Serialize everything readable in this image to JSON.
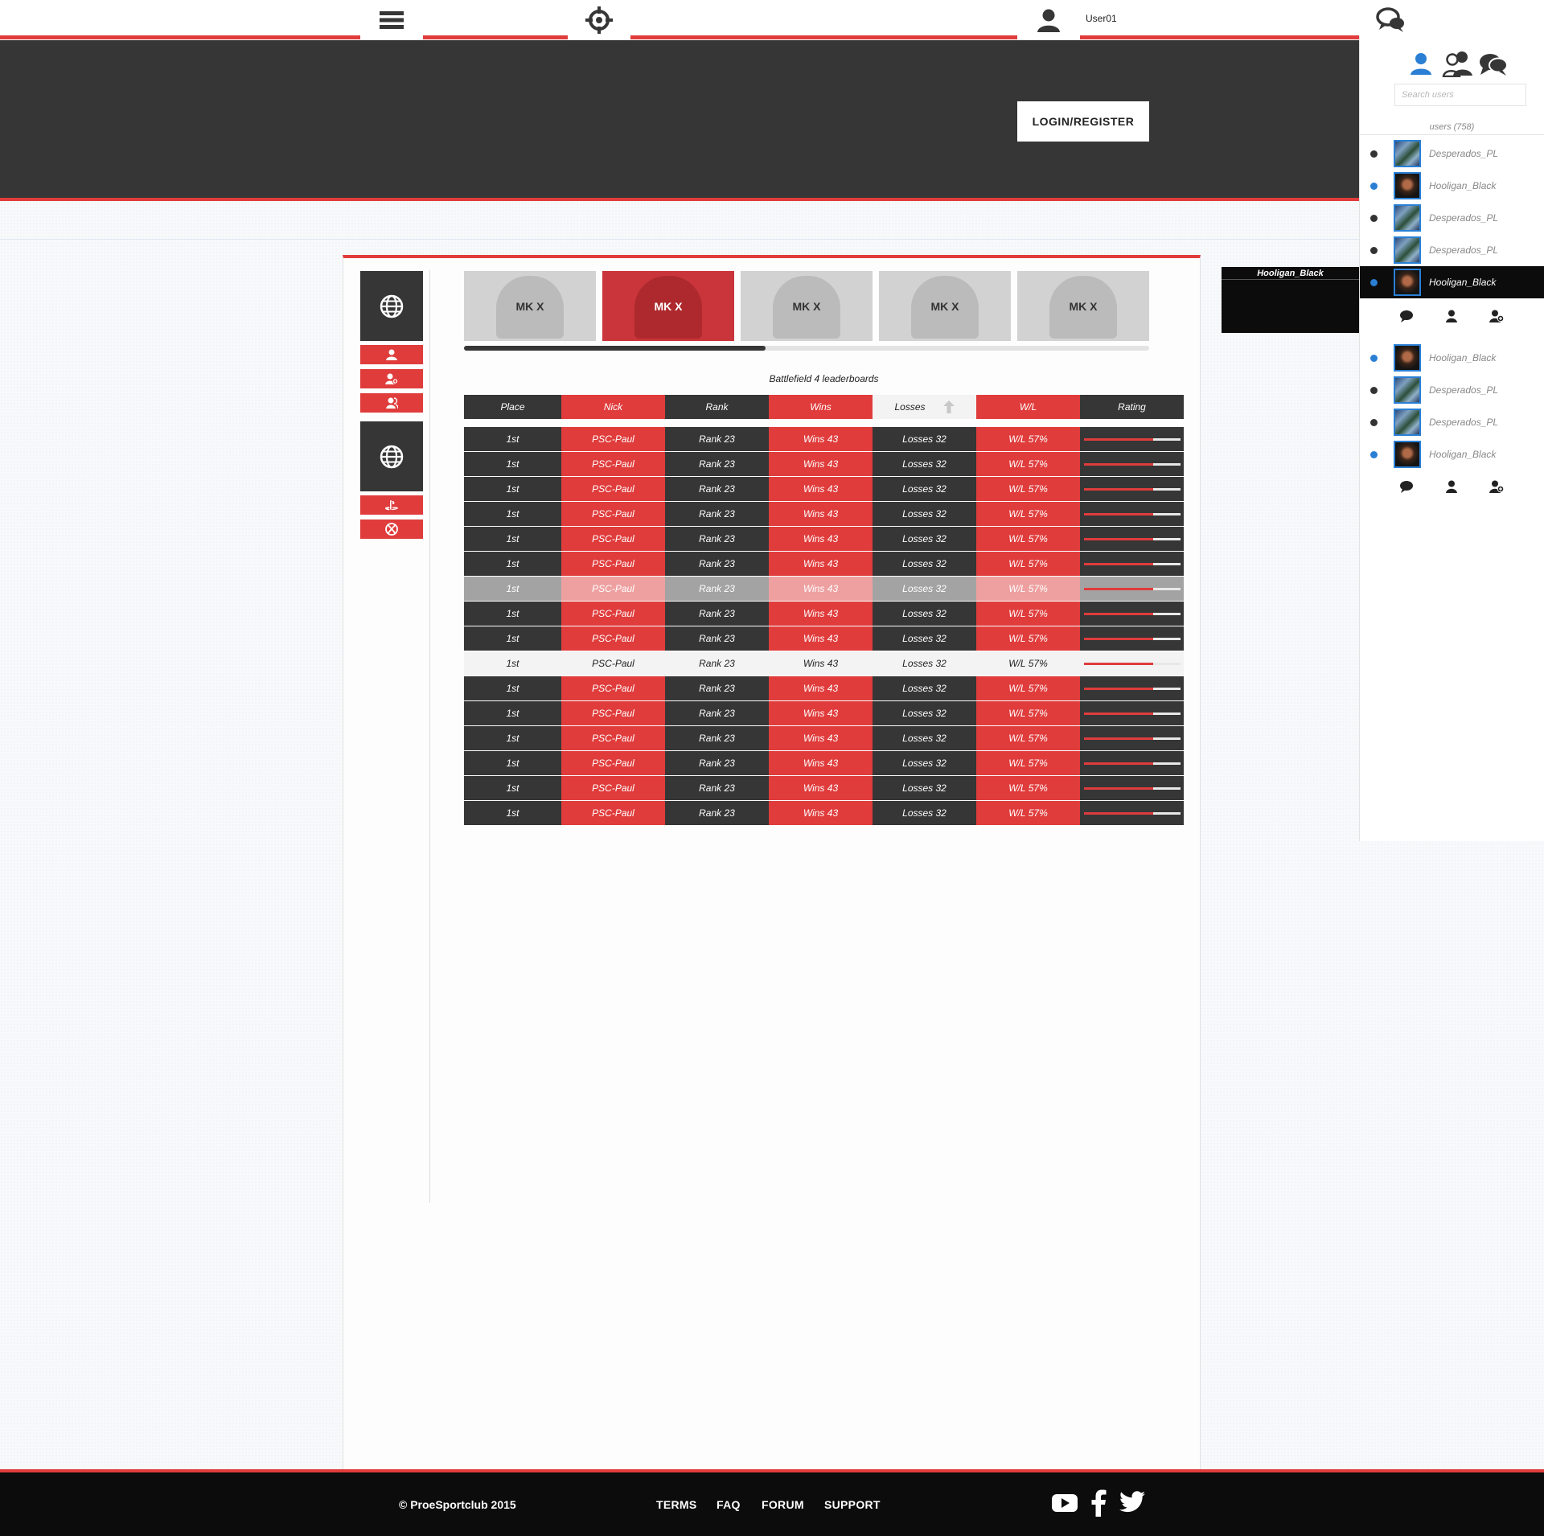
{
  "topnav": {
    "menu_icon": "hamburger-icon",
    "target_icon": "crosshair-icon",
    "user_icon": "user-icon",
    "username": "User01",
    "chat_icon": "chat-bubbles-icon"
  },
  "header": {
    "login_label": "LOGIN/REGISTER"
  },
  "sidebar_left": {
    "groups": [
      {
        "icon": "globe-icon",
        "buttons": [
          "user-icon",
          "user-add-icon",
          "users-icon"
        ]
      },
      {
        "icon": "globe-icon",
        "buttons": [
          "playstation-icon",
          "xbox-icon"
        ]
      }
    ]
  },
  "games": {
    "tiles": [
      {
        "label": "MK X",
        "selected": false
      },
      {
        "label": "MK X",
        "selected": true
      },
      {
        "label": "MK X",
        "selected": false
      },
      {
        "label": "MK X",
        "selected": false
      },
      {
        "label": "MK X",
        "selected": false
      }
    ],
    "scroll_fraction": 0.44
  },
  "leaderboard": {
    "title": "Battlefield 4 leaderboards",
    "columns": [
      "Place",
      "Nick",
      "Rank",
      "Wins",
      "Losses",
      "W/L",
      "Rating"
    ],
    "sorted_column": "Losses",
    "sort_icon": "arrow-up-icon",
    "rows": [
      {
        "place": "1st",
        "nick": "PSC-Paul",
        "rank": "Rank 23",
        "wins": "Wins 43",
        "losses": "Losses 32",
        "wl": "W/L 57%",
        "rating": 0.72,
        "style": "normal"
      },
      {
        "place": "1st",
        "nick": "PSC-Paul",
        "rank": "Rank 23",
        "wins": "Wins 43",
        "losses": "Losses 32",
        "wl": "W/L 57%",
        "rating": 0.72,
        "style": "normal"
      },
      {
        "place": "1st",
        "nick": "PSC-Paul",
        "rank": "Rank 23",
        "wins": "Wins 43",
        "losses": "Losses 32",
        "wl": "W/L 57%",
        "rating": 0.72,
        "style": "normal"
      },
      {
        "place": "1st",
        "nick": "PSC-Paul",
        "rank": "Rank 23",
        "wins": "Wins 43",
        "losses": "Losses 32",
        "wl": "W/L 57%",
        "rating": 0.72,
        "style": "normal"
      },
      {
        "place": "1st",
        "nick": "PSC-Paul",
        "rank": "Rank 23",
        "wins": "Wins 43",
        "losses": "Losses 32",
        "wl": "W/L 57%",
        "rating": 0.72,
        "style": "normal"
      },
      {
        "place": "1st",
        "nick": "PSC-Paul",
        "rank": "Rank 23",
        "wins": "Wins 43",
        "losses": "Losses 32",
        "wl": "W/L 57%",
        "rating": 0.72,
        "style": "normal"
      },
      {
        "place": "1st",
        "nick": "PSC-Paul",
        "rank": "Rank 23",
        "wins": "Wins 43",
        "losses": "Losses 32",
        "wl": "W/L 57%",
        "rating": 0.72,
        "style": "faded"
      },
      {
        "place": "1st",
        "nick": "PSC-Paul",
        "rank": "Rank 23",
        "wins": "Wins 43",
        "losses": "Losses 32",
        "wl": "W/L 57%",
        "rating": 0.72,
        "style": "normal"
      },
      {
        "place": "1st",
        "nick": "PSC-Paul",
        "rank": "Rank 23",
        "wins": "Wins 43",
        "losses": "Losses 32",
        "wl": "W/L 57%",
        "rating": 0.72,
        "style": "normal"
      },
      {
        "place": "1st",
        "nick": "PSC-Paul",
        "rank": "Rank 23",
        "wins": "Wins 43",
        "losses": "Losses 32",
        "wl": "W/L 57%",
        "rating": 0.72,
        "style": "light"
      },
      {
        "place": "1st",
        "nick": "PSC-Paul",
        "rank": "Rank 23",
        "wins": "Wins 43",
        "losses": "Losses 32",
        "wl": "W/L 57%",
        "rating": 0.72,
        "style": "normal"
      },
      {
        "place": "1st",
        "nick": "PSC-Paul",
        "rank": "Rank 23",
        "wins": "Wins 43",
        "losses": "Losses 32",
        "wl": "W/L 57%",
        "rating": 0.72,
        "style": "normal"
      },
      {
        "place": "1st",
        "nick": "PSC-Paul",
        "rank": "Rank 23",
        "wins": "Wins 43",
        "losses": "Losses 32",
        "wl": "W/L 57%",
        "rating": 0.72,
        "style": "normal"
      },
      {
        "place": "1st",
        "nick": "PSC-Paul",
        "rank": "Rank 23",
        "wins": "Wins 43",
        "losses": "Losses 32",
        "wl": "W/L 57%",
        "rating": 0.72,
        "style": "normal"
      },
      {
        "place": "1st",
        "nick": "PSC-Paul",
        "rank": "Rank 23",
        "wins": "Wins 43",
        "losses": "Losses 32",
        "wl": "W/L 57%",
        "rating": 0.72,
        "style": "normal"
      },
      {
        "place": "1st",
        "nick": "PSC-Paul",
        "rank": "Rank 23",
        "wins": "Wins 43",
        "losses": "Losses 32",
        "wl": "W/L 57%",
        "rating": 0.72,
        "style": "normal"
      }
    ]
  },
  "sidebar_right": {
    "tabs": [
      "user-icon",
      "users-icon",
      "chat-icon"
    ],
    "search_placeholder": "Search users",
    "users_count_label": "users (758)",
    "users": [
      {
        "name": "Desperados_PL",
        "online": false,
        "selected": false
      },
      {
        "name": "Hooligan_Black",
        "online": true,
        "selected": false
      },
      {
        "name": "Desperados_PL",
        "online": false,
        "selected": false
      },
      {
        "name": "Desperados_PL",
        "online": false,
        "selected": false
      },
      {
        "name": "Hooligan_Black",
        "online": true,
        "selected": true
      },
      {
        "name": "Hooligan_Black",
        "online": true,
        "selected": false
      },
      {
        "name": "Desperados_PL",
        "online": false,
        "selected": false
      },
      {
        "name": "Desperados_PL",
        "online": false,
        "selected": false
      },
      {
        "name": "Hooligan_Black",
        "online": true,
        "selected": false
      }
    ],
    "tooltip_name": "Hooligan_Black",
    "colors": {
      "online": "#2a7fd4",
      "offline": "#333333"
    }
  },
  "footer": {
    "copyright": "© ProeSportclub 2015",
    "links": [
      "TERMS",
      "FAQ",
      "FORUM",
      "SUPPORT"
    ],
    "social": [
      "youtube-icon",
      "facebook-icon",
      "twitter-icon"
    ]
  },
  "colors": {
    "accent": "#e03c3c",
    "dark": "#363636",
    "black": "#0c0c0c"
  }
}
